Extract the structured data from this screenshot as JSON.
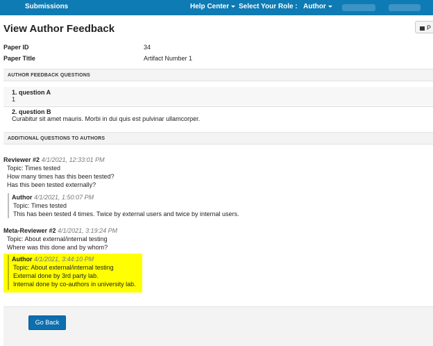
{
  "topbar": {
    "submissions": "Submissions",
    "help_center": "Help Center",
    "role_label": "Select Your Role :",
    "role_value": "Author"
  },
  "page": {
    "title": "View Author Feedback",
    "print_label": "P"
  },
  "paper": {
    "id_label": "Paper ID",
    "id_value": "34",
    "title_label": "Paper Title",
    "title_value": "Artifact Number 1"
  },
  "feedback": {
    "heading": "AUTHOR FEEDBACK QUESTIONS",
    "questions": [
      {
        "title": "1. question A",
        "answer": "1"
      },
      {
        "title": "2. question B",
        "answer": "Curabitur sit amet mauris. Morbi in dui quis est pulvinar ullamcorper."
      }
    ]
  },
  "additional": {
    "heading": "ADDITIONAL QUESTIONS TO AUTHORS",
    "threads": [
      {
        "author": "Reviewer #2",
        "time": "4/1/2021, 12:33:01 PM",
        "lines": [
          "Topic: Times tested",
          "How many times has this been tested?",
          "Has this been tested externally?"
        ],
        "reply": {
          "author": "Author",
          "time": "4/1/2021, 1:50:07 PM",
          "lines": [
            "Topic: Times tested",
            "This has been tested 4 times. Twice by external users and twice by internal users."
          ]
        }
      },
      {
        "author": "Meta-Reviewer #2",
        "time": "4/1/2021, 3:19:24 PM",
        "lines": [
          "Topic: About external/internal testing",
          "Where was this done and by whom?"
        ],
        "reply": {
          "author": "Author",
          "time": "4/1/2021, 3:44:10 PM",
          "lines": [
            "Topic: About external/internal testing",
            "External done by 3rd party lab.",
            "Internal done by co-authors in university lab."
          ]
        }
      }
    ]
  },
  "footer": {
    "go_back": "Go Back"
  },
  "colors": {
    "nav": "#0e7bb4",
    "button": "#0d6fae",
    "highlight": "#ffff00"
  }
}
